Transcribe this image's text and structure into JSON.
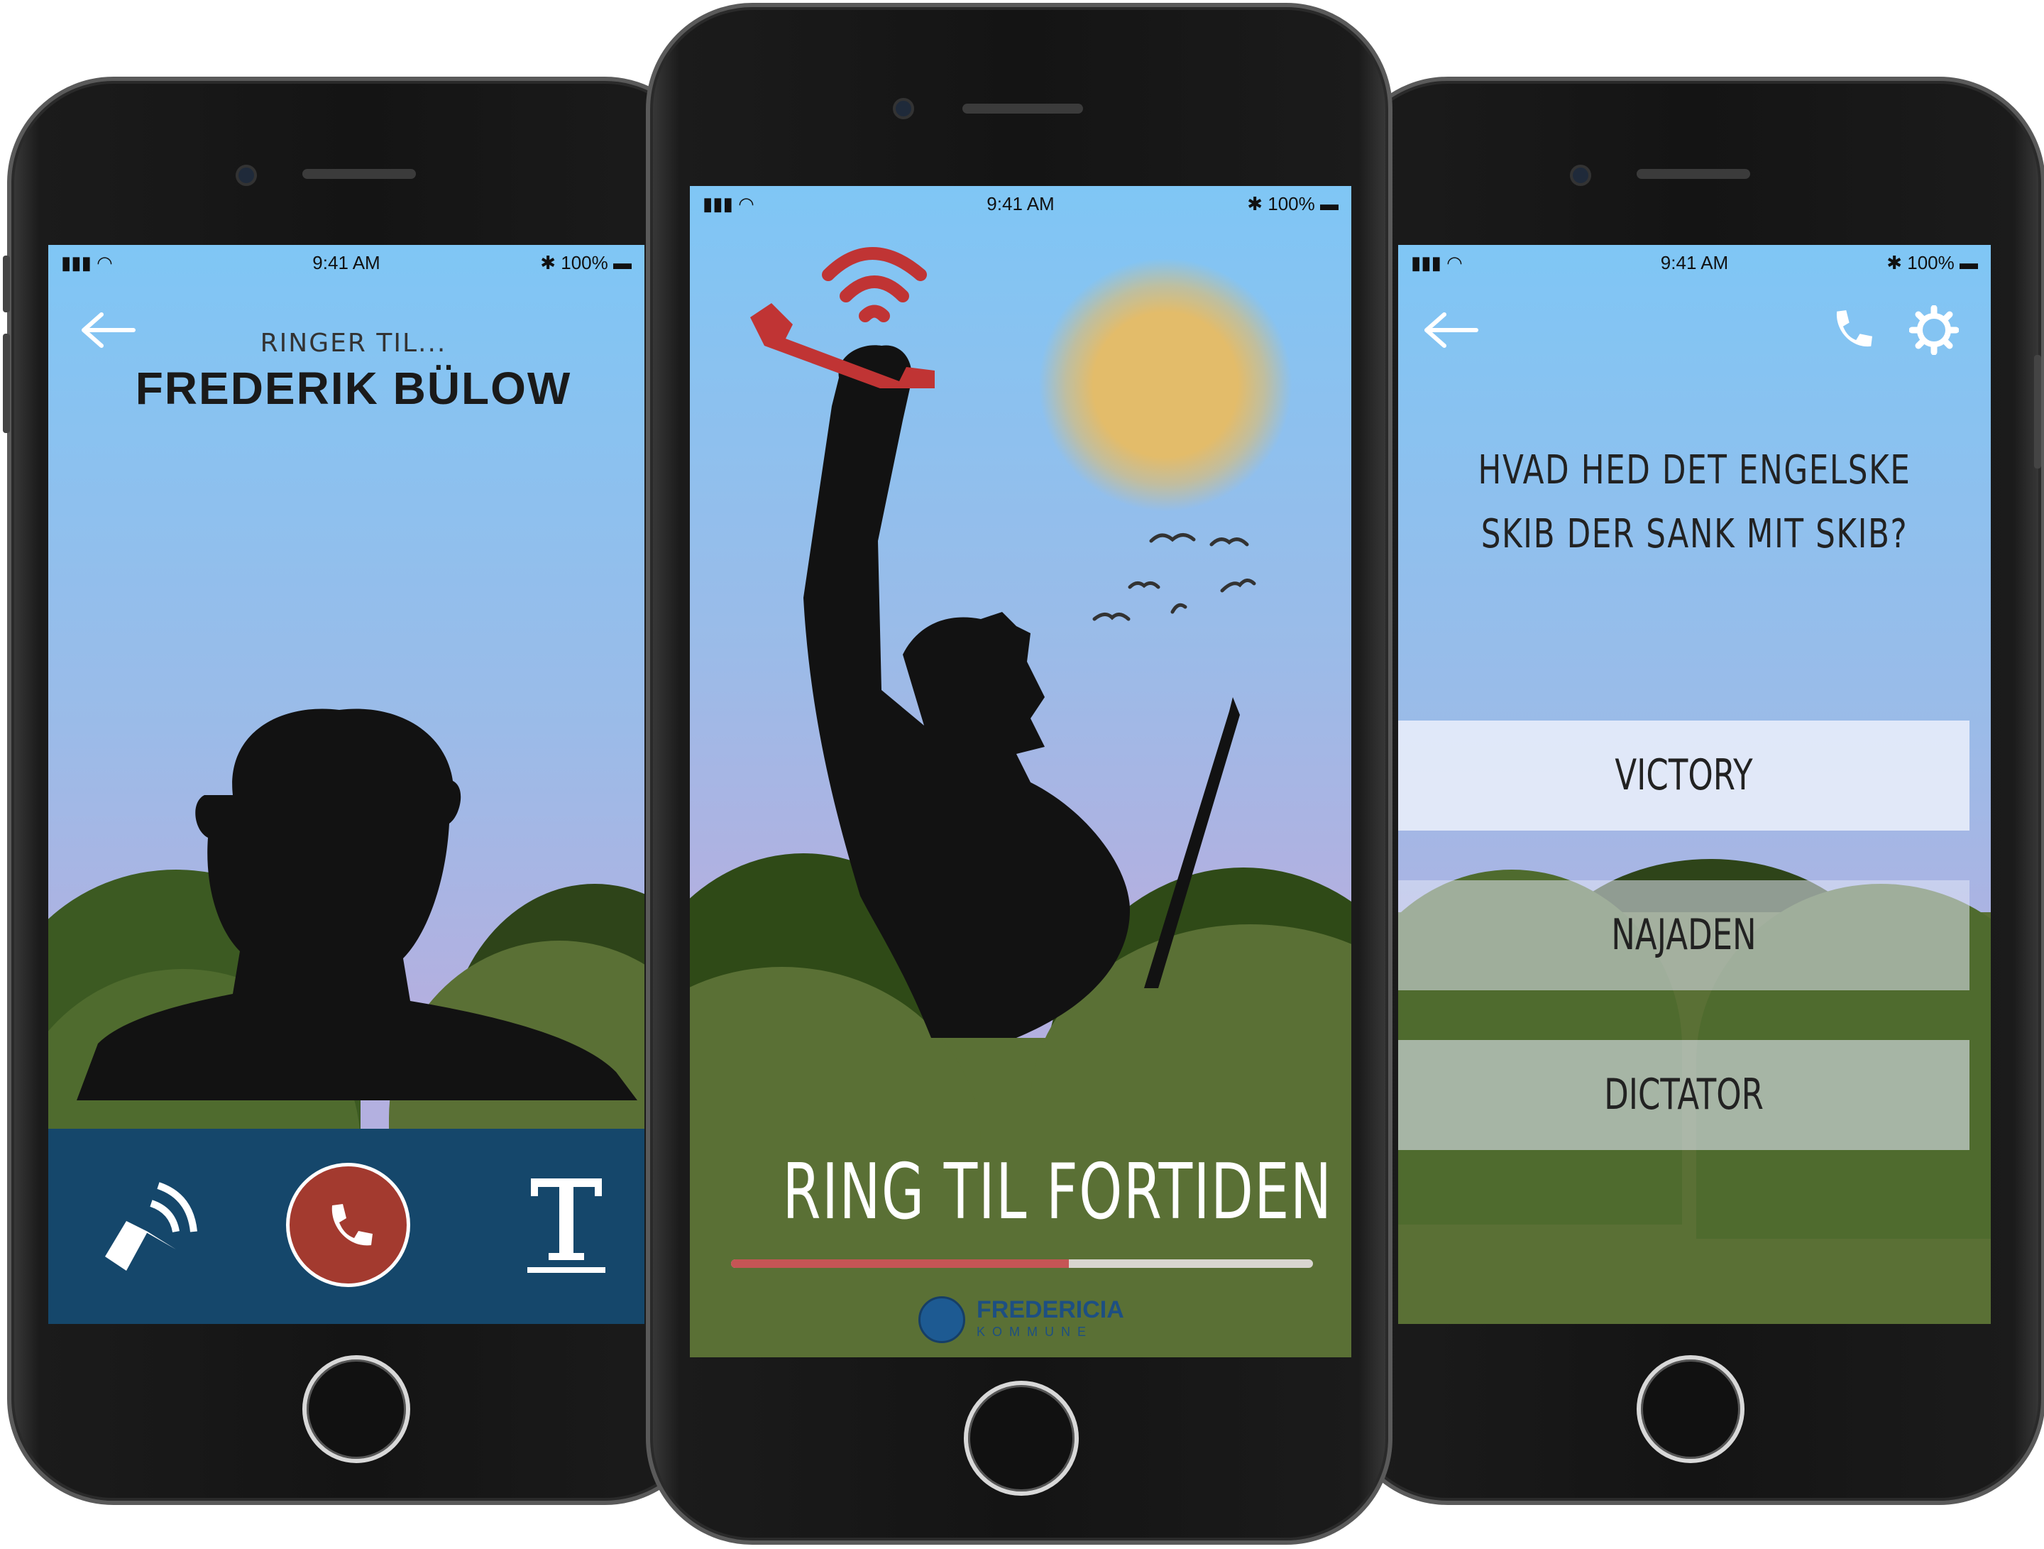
{
  "status_bar": {
    "time": "9:41 AM",
    "battery": "100%"
  },
  "left_screen": {
    "subtitle": "RINGER TIL...",
    "caller_name": "FREDERIK BÜLOW"
  },
  "center_screen": {
    "title": "RING TIL FORTIDEN",
    "progress": 0.58,
    "logo_name": "FREDERICIA",
    "logo_sub": "KOMMUNE"
  },
  "right_screen": {
    "question_line1": "HVAD HED DET  ENGELSKE",
    "question_line2": "SKIB DER SANK MIT SKIB?",
    "answers": [
      "VICTORY",
      "NAJADEN",
      "DICTATOR"
    ]
  },
  "colors": {
    "sky_top": "#7fc6f5",
    "sky_bottom": "#b3b0e0",
    "grass": "#5a7035",
    "grass_dark": "#2f4a17",
    "call_bar": "#15476b",
    "end_call": "#a33a2f",
    "progress_fill": "#c65555",
    "progress_track": "#d9d6d0"
  }
}
